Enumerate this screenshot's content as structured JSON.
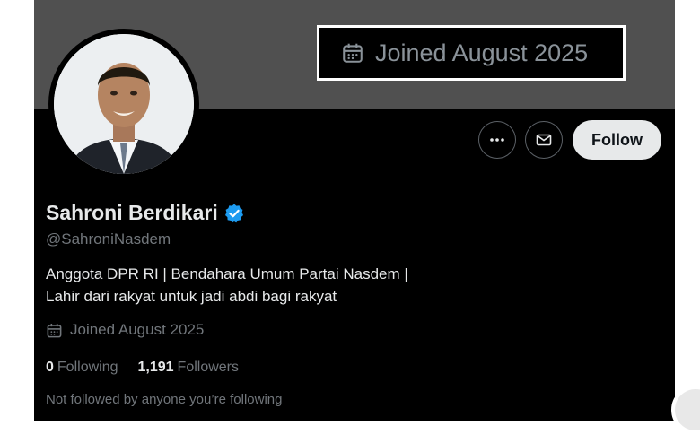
{
  "header": {
    "callout_joined": "Joined August 2025"
  },
  "profile": {
    "display_name": "Sahroni Berdikari",
    "handle": "@SahroniNasdem",
    "bio_line1": "Anggota DPR RI | Bendahara Umum Partai Nasdem |",
    "bio_line2": "Lahir dari rakyat untuk jadi abdi bagi rakyat",
    "joined": "Joined August 2025",
    "following_count": "0",
    "following_label": "Following",
    "followers_count": "1,191",
    "followers_label": "Followers",
    "not_followed_text": "Not followed by anyone you’re following"
  },
  "actions": {
    "follow_label": "Follow"
  },
  "icons": {
    "more": "more-icon",
    "message": "mail-icon",
    "verified": "verified-badge-icon",
    "calendar": "calendar-icon"
  },
  "colors": {
    "background": "#000000",
    "banner": "#505050",
    "text_primary": "#e7e9ea",
    "text_secondary": "#71767b",
    "verified_blue": "#1d9bf0",
    "follow_button": "#e7e9ea"
  }
}
